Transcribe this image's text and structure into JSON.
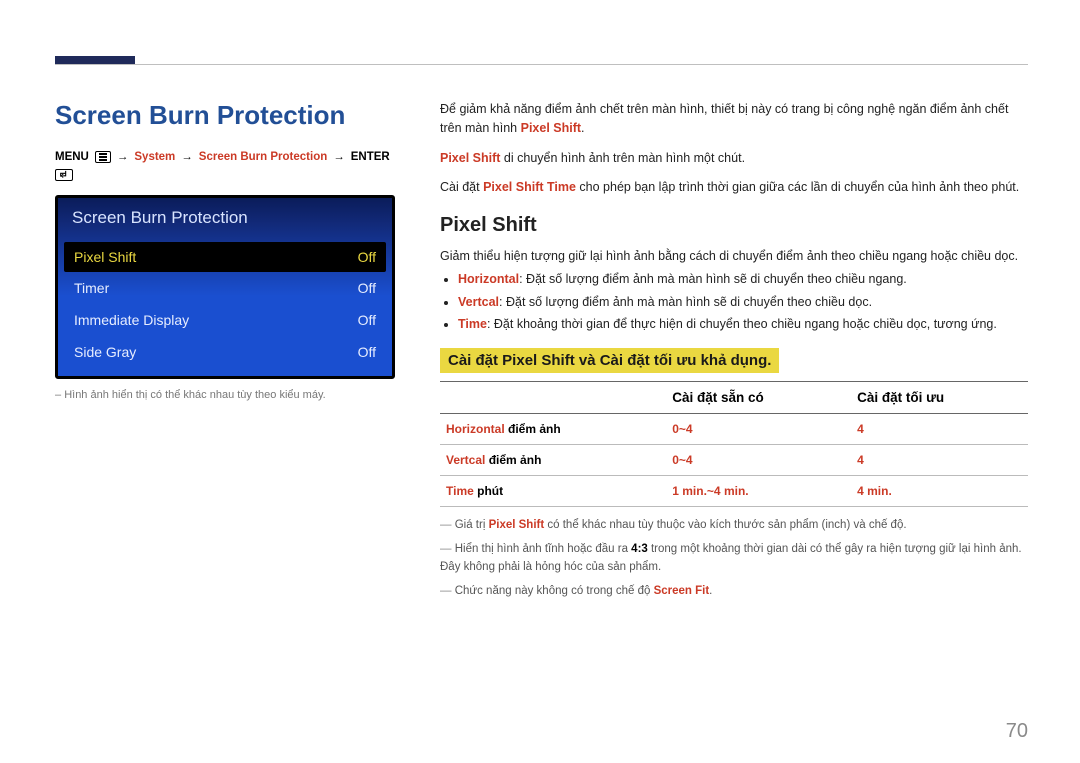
{
  "page_number": "70",
  "section_title": "Screen Burn Protection",
  "breadcrumb": {
    "menu": "MENU",
    "system": "System",
    "sbp": "Screen Burn Protection",
    "enter": "ENTER"
  },
  "osd": {
    "title": "Screen Burn Protection",
    "rows": [
      {
        "label": "Pixel Shift",
        "value": "Off",
        "selected": true
      },
      {
        "label": "Timer",
        "value": "Off",
        "selected": false
      },
      {
        "label": "Immediate Display",
        "value": "Off",
        "selected": false
      },
      {
        "label": "Side Gray",
        "value": "Off",
        "selected": false
      }
    ],
    "caption": "Hình ảnh hiển thị có thể khác nhau tùy theo kiểu máy."
  },
  "intro": {
    "p1_pre": "Để giảm khả năng điểm ảnh chết trên màn hình, thiết bị này có trang bị công nghệ ngăn điểm ảnh chết trên màn hình ",
    "p1_kw": "Pixel Shift",
    "p1_post": ".",
    "p2_kw": "Pixel Shift",
    "p2_post": " di chuyển hình ảnh trên màn hình một chút.",
    "p3_pre": "Cài đặt ",
    "p3_kw": "Pixel Shift Time",
    "p3_post": " cho phép bạn lập trình thời gian giữa các lần di chuyển của hình ảnh theo phút."
  },
  "sub_title": "Pixel Shift",
  "sub_intro": "Giảm thiểu hiện tượng giữ lại hình ảnh bằng cách di chuyển điểm ảnh theo chiều ngang hoặc chiều dọc.",
  "bullets": [
    {
      "label": "Horizontal",
      "text": ": Đặt số lượng điểm ảnh mà màn hình sẽ di chuyển theo chiều ngang.",
      "red": true
    },
    {
      "label": "Vertcal",
      "text": ": Đặt số lượng điểm ảnh mà màn hình sẽ di chuyển theo chiều dọc.",
      "red": true
    },
    {
      "label": "Time",
      "text": ": Đặt khoảng thời gian để thực hiện di chuyển theo chiều ngang hoặc chiều dọc, tương ứng.",
      "red": true
    }
  ],
  "highlight": "Cài đặt Pixel Shift và Cài đặt tối ưu khả dụng.",
  "table": {
    "head": {
      "c1": "",
      "c2": "Cài đặt sẵn có",
      "c3": "Cài đặt tối ưu"
    },
    "rows": [
      {
        "label": "Horizontal",
        "unit": "điểm ảnh",
        "avail": "0~4",
        "opt": "4"
      },
      {
        "label": "Vertcal",
        "unit": "điểm ảnh",
        "avail": "0~4",
        "opt": "4"
      },
      {
        "label": "Time",
        "unit": "phút",
        "avail": "1 min.~4 min.",
        "opt": "4 min."
      }
    ]
  },
  "notes": {
    "n1_pre": "Giá trị ",
    "n1_kw": "Pixel Shift",
    "n1_post": " có thể khác nhau tùy thuộc vào kích thước sản phẩm (inch) và chế độ.",
    "n2_pre": "Hiển thị hình ảnh tĩnh hoặc đầu ra ",
    "n2_ratio": "4:3",
    "n2_post": " trong một khoảng thời gian dài có thể gây ra hiện tượng giữ lại hình ảnh. Đây không phải là hỏng hóc của sản phẩm.",
    "n3_pre": "Chức năng này không có trong chế độ ",
    "n3_kw": "Screen Fit",
    "n3_post": "."
  }
}
